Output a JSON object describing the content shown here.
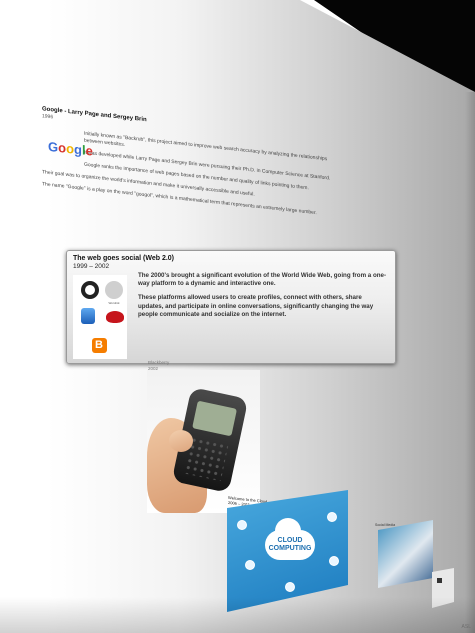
{
  "google_block": {
    "title": "Google - Larry Page and Sergey Brin",
    "year": "1996",
    "logo_text": [
      "G",
      "o",
      "o",
      "g",
      "l",
      "e"
    ],
    "logo_colors": [
      "#3b6ed8",
      "#d7322b",
      "#f0b400",
      "#3b6ed8",
      "#2f9e3f",
      "#d7322b"
    ],
    "para1": "Initially known as \"Backrub\", this project aimed to improve web search accuracy by analyzing the relationships between websites.",
    "para2": "It was developed while Larry Page and Sergey Brin were pursuing their Ph.D. in Computer Science at Stanford.",
    "para3": "Google ranks the importance of web pages based on the number and quality of links pointing to them.",
    "para4": "Their goal was to organize the world's information and make it universally accessible and useful.",
    "para5": "The name \"Google\" is a play on the word \"googol\", which is a mathematical term that represents an extremely large number."
  },
  "card": {
    "title": "The web goes social (Web 2.0)",
    "years": "1999 – 2002",
    "text1": "The 2000's brought a significant evolution of the World Wide Web, going from a one-way platform to a dynamic and interactive one.",
    "text2": "These platforms allowed users to create profiles, connect with others, share updates, and participate in online conversations, significantly changing the way people communicate and socialize on the internet.",
    "logo_wordnik": "Wordnik"
  },
  "blackberry": {
    "caption_name": "Blackberry",
    "caption_year": "2002"
  },
  "cloud": {
    "title": "Welcome to the Cloud",
    "years": "2006 – 2011",
    "label": "CLOUD COMPUTING"
  },
  "right_item": {
    "caption": "Social Media"
  },
  "watermark": "ASL"
}
